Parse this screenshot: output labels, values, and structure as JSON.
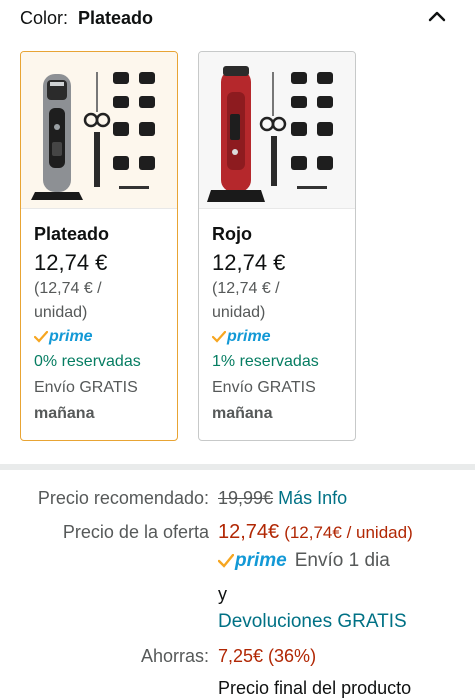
{
  "color_selector": {
    "label": "Color:",
    "selected_value": "Plateado",
    "collapse_icon": "chevron-up-icon"
  },
  "variants": [
    {
      "name": "Plateado",
      "price": "12,74 €",
      "unit_price_line1": "(12,74 € /",
      "unit_price_line2": "unidad)",
      "prime_label": "prime",
      "reserved": "0% reservadas",
      "shipping": "Envío GRATIS",
      "delivery_day": "mañana",
      "selected": true,
      "body_color": "#8d9094"
    },
    {
      "name": "Rojo",
      "price": "12,74 €",
      "unit_price_line1": "(12,74 € /",
      "unit_price_line2": "unidad)",
      "prime_label": "prime",
      "reserved": "1% reservadas",
      "shipping": "Envío GRATIS",
      "delivery_day": "mañana",
      "selected": false,
      "body_color": "#b5282c"
    }
  ],
  "pricing": {
    "recommended_label": "Precio recomendado:",
    "recommended_price": "19,99€",
    "more_info": "Más Info",
    "offer_label": "Precio de la oferta",
    "offer_price": "12,74€",
    "offer_unit": "(12,74€ / unidad)",
    "prime_label": "prime",
    "shipping_text": "Envío 1 dia",
    "conjunction": "y",
    "returns_link": "Devoluciones GRATIS",
    "savings_label": "Ahorras:",
    "savings_value": "7,25€ (36%)",
    "final_price_text": "Precio final del producto"
  },
  "colors": {
    "selected_border": "#e8a434",
    "prime_blue": "#1399d6",
    "prime_check": "#f6a621",
    "green": "#067d62",
    "link": "#007185",
    "price_red": "#b12704"
  }
}
